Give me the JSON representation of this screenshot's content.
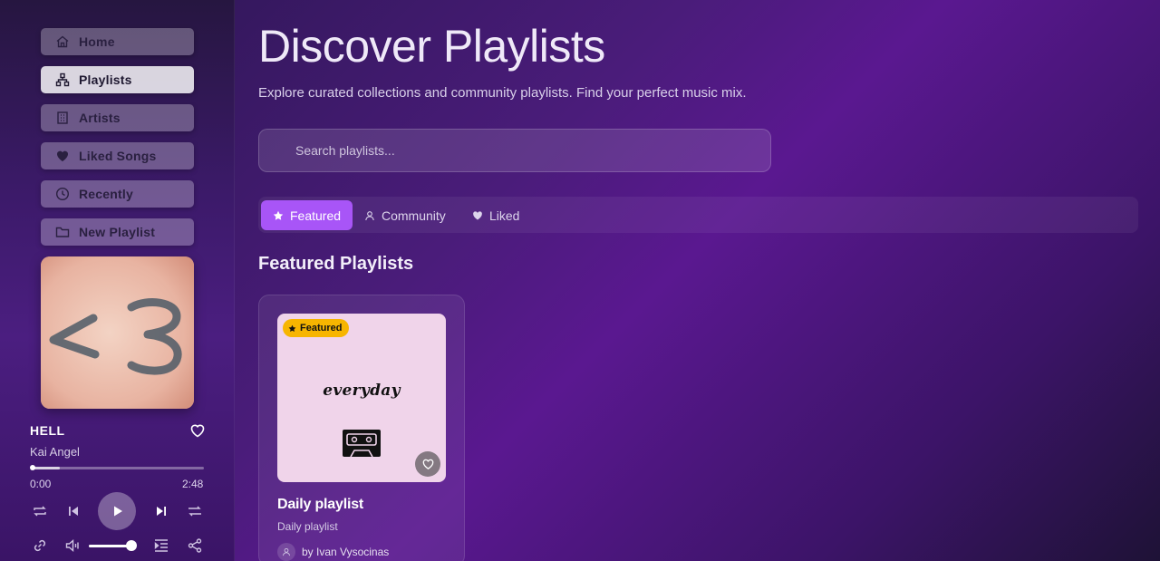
{
  "sidebar": {
    "nav": [
      {
        "label": "Home",
        "icon": "home-icon",
        "active": false
      },
      {
        "label": "Playlists",
        "icon": "hierarchy-icon",
        "active": true
      },
      {
        "label": "Artists",
        "icon": "building-icon",
        "active": false
      },
      {
        "label": "Liked Songs",
        "icon": "heart-icon",
        "active": false
      },
      {
        "label": "Recently",
        "icon": "clock-icon",
        "active": false
      },
      {
        "label": "New Playlist",
        "icon": "folder-icon",
        "active": false
      }
    ]
  },
  "player": {
    "title": "HELL",
    "artist": "Kai Angel",
    "current_time": "0:00",
    "duration": "2:48",
    "progress_fraction": 0.0,
    "volume_fraction": 1.0,
    "album_art_text": "<3"
  },
  "main": {
    "title": "Discover Playlists",
    "subtitle": "Explore curated collections and community playlists. Find your perfect music mix.",
    "search_placeholder": "Search playlists...",
    "tabs": [
      {
        "label": "Featured",
        "icon": "star-icon",
        "active": true
      },
      {
        "label": "Community",
        "icon": "user-icon",
        "active": false
      },
      {
        "label": "Liked",
        "icon": "heart-icon",
        "active": false
      }
    ],
    "section_title": "Featured Playlists",
    "cards": [
      {
        "badge": "Featured",
        "cover_text": "everyday",
        "title": "Daily playlist",
        "description": "Daily playlist",
        "author": "by Ivan Vysocinas"
      }
    ]
  },
  "colors": {
    "accent": "#a855f7",
    "badge": "#f7b500",
    "cover_bg": "#f0d4ea"
  }
}
